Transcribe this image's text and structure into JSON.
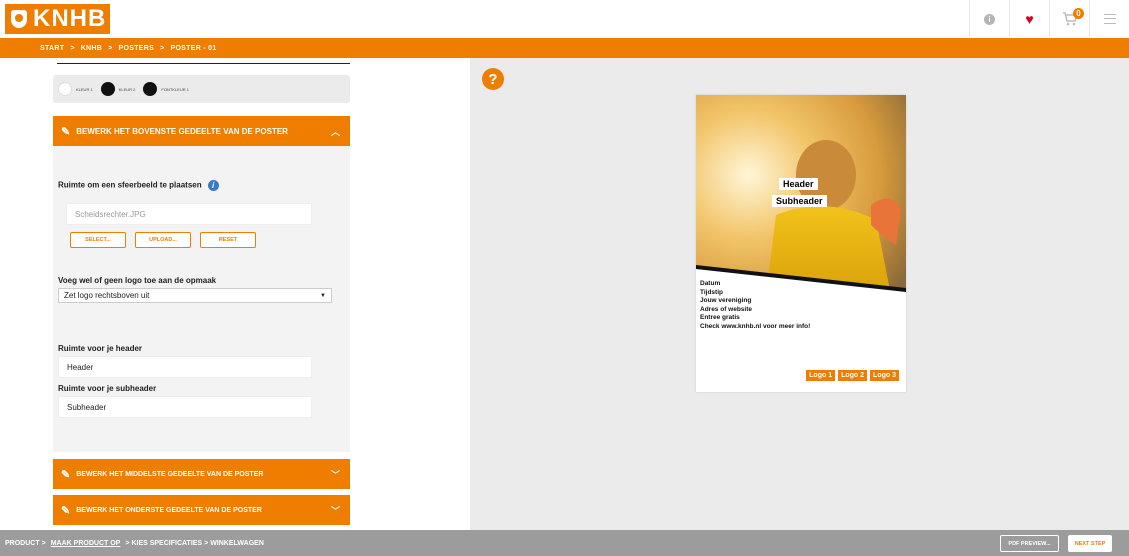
{
  "brand": {
    "name": "KNHB"
  },
  "header": {
    "info_icon": "info-icon",
    "heart_icon": "heart-icon",
    "cart_icon": "cart-icon",
    "cart_count": "0",
    "menu_icon": "hamburger-menu-icon"
  },
  "breadcrumb": [
    "START",
    ">",
    "KNHB",
    ">",
    "POSTERS",
    ">",
    "POSTER - 01"
  ],
  "colors": {
    "accent": "#ef7d00",
    "swatches": [
      {
        "label": "KLEUR 1",
        "color": "#ffffff"
      },
      {
        "label": "KLEUR 2",
        "color": "#111111"
      },
      {
        "label": "FONTKLEUR 1",
        "color": "#111111"
      }
    ]
  },
  "top_section": {
    "title": "BEWERK HET BOVENSTE GEDEELTE VAN DE POSTER",
    "image_label": "Ruimte om een sfeerbeeld te plaatsen",
    "image_value": "Scheidsrechter.JPG",
    "buttons": {
      "select": "SELECT...",
      "upload": "UPLOAD...",
      "reset": "RESET"
    },
    "logo_label": "Voeg wel of geen logo toe aan de opmaak",
    "logo_selected": "Zet logo rechtsboven uit",
    "header_label": "Ruimte voor je header",
    "header_value": "Header",
    "subheader_label": "Ruimte voor je subheader",
    "subheader_value": "Subheader"
  },
  "middle_section": {
    "title": "BEWERK HET MIDDELSTE GEDEELTE VAN DE POSTER"
  },
  "bottom_section": {
    "title": "BEWERK HET ONDERSTE GEDEELTE VAN DE POSTER"
  },
  "poster": {
    "header": "Header",
    "subheader": "Subheader",
    "info_lines": [
      "Datum",
      "Tijdstip",
      "Jouw vereniging",
      "Adres of website",
      "Entree gratis",
      "Check www.knhb.nl voor meer info!"
    ],
    "logos": [
      "Logo 1",
      "Logo 2",
      "Logo 3"
    ]
  },
  "footer": {
    "steps": [
      "PRODUCT",
      ">",
      "MAAK PRODUCT OP",
      ">",
      "KIES SPECIFICATIES",
      ">",
      "WINKELWAGEN"
    ],
    "pdf_preview": "PDF PREVIEW...",
    "next_step": "NEXT STEP"
  }
}
